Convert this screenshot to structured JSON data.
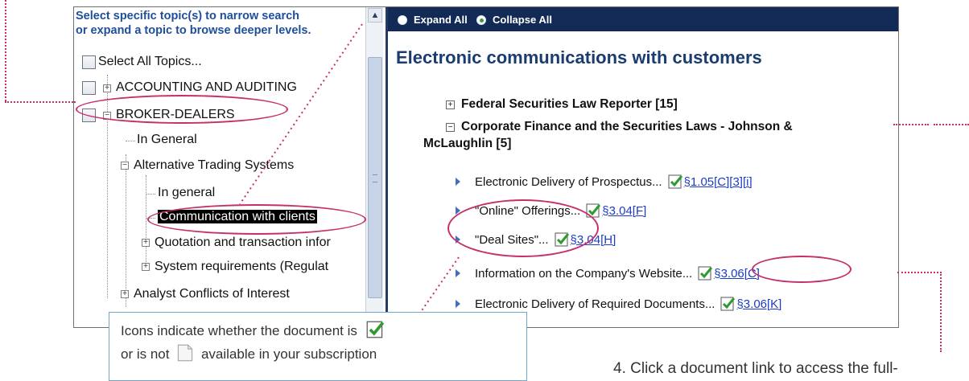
{
  "left": {
    "header_line1": "Select specific topic(s) to narrow search",
    "header_line2": "or expand a topic to browse deeper levels.",
    "tree": {
      "select_all": "Select All Topics...",
      "accounting": "ACCOUNTING AND AUDITING",
      "broker_dealers": "BROKER-DEALERS",
      "in_general": "In General",
      "ats": "Alternative Trading Systems",
      "ats_in_general": "In general",
      "communication": "Communication with clients",
      "quotation": "Quotation and transaction infor",
      "system_req": "System requirements (Regulat",
      "analyst": "Analyst Conflicts of Interest"
    }
  },
  "right": {
    "toolbar": {
      "expand_all": "Expand All",
      "collapse_all": "Collapse All"
    },
    "title": "Electronic communications with customers",
    "sections": {
      "federal": "Federal Securities Law Reporter [15]",
      "corporate_line1": "Corporate Finance and the Securities Laws - Johnson &",
      "corporate_line2": "McLaughlin [5]"
    },
    "results": [
      {
        "label": "Electronic Delivery of Prospectus...",
        "link": "§1.05[C][3][i]"
      },
      {
        "label": "\"Online\" Offerings...",
        "link": "§3.04[F]"
      },
      {
        "label": "\"Deal Sites\"...",
        "link": "§3.04[H]"
      },
      {
        "label": "Information on the Company's Website...",
        "link": "§3.06[C]"
      },
      {
        "label": "Electronic Delivery of Required Documents...",
        "link": "§3.06[K]"
      }
    ]
  },
  "callout": {
    "line1": "Icons indicate whether the document is",
    "line2_a": "or is not",
    "line2_b": "available in your subscription"
  },
  "note": "4. Click a document link to access the full-",
  "colors": {
    "annotation": "#c52f6b",
    "toolbar": "#132a56",
    "title": "#1b3c70",
    "link": "#1b3cc6"
  }
}
